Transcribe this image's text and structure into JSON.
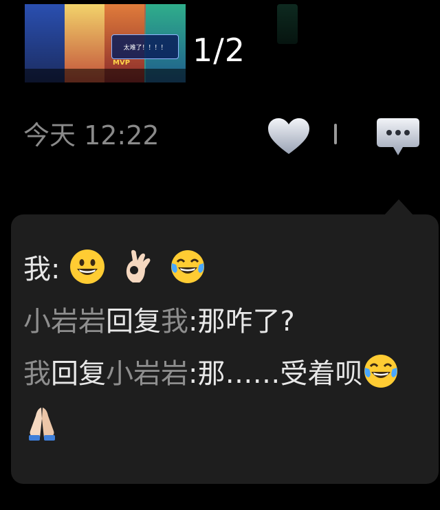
{
  "post": {
    "thumbnail": {
      "banner_text": "太难了！！！！",
      "badge_text": "MVP"
    },
    "page_counter": "1/2",
    "timestamp": "今天 12:22"
  },
  "actions": {
    "like_icon": "heart-icon",
    "comment_icon": "comment-bubble-icon"
  },
  "comments": [
    {
      "author": "我",
      "separator": ":",
      "emojis": [
        "grinning-face",
        "ok-hand",
        "tears-of-joy"
      ]
    },
    {
      "author": "小岩岩",
      "verb": "回复",
      "target": "我",
      "separator": ":",
      "text": "那咋了?"
    },
    {
      "author": "我",
      "verb": "回复",
      "target": "小岩岩",
      "separator": ":",
      "text": "那……受着呗",
      "emojis": [
        "tears-of-joy",
        "folded-hands"
      ]
    }
  ],
  "colors": {
    "background": "#000000",
    "panel": "#1e1e1e",
    "name_gray": "#8e8e8e",
    "text": "#e8e8e8"
  }
}
